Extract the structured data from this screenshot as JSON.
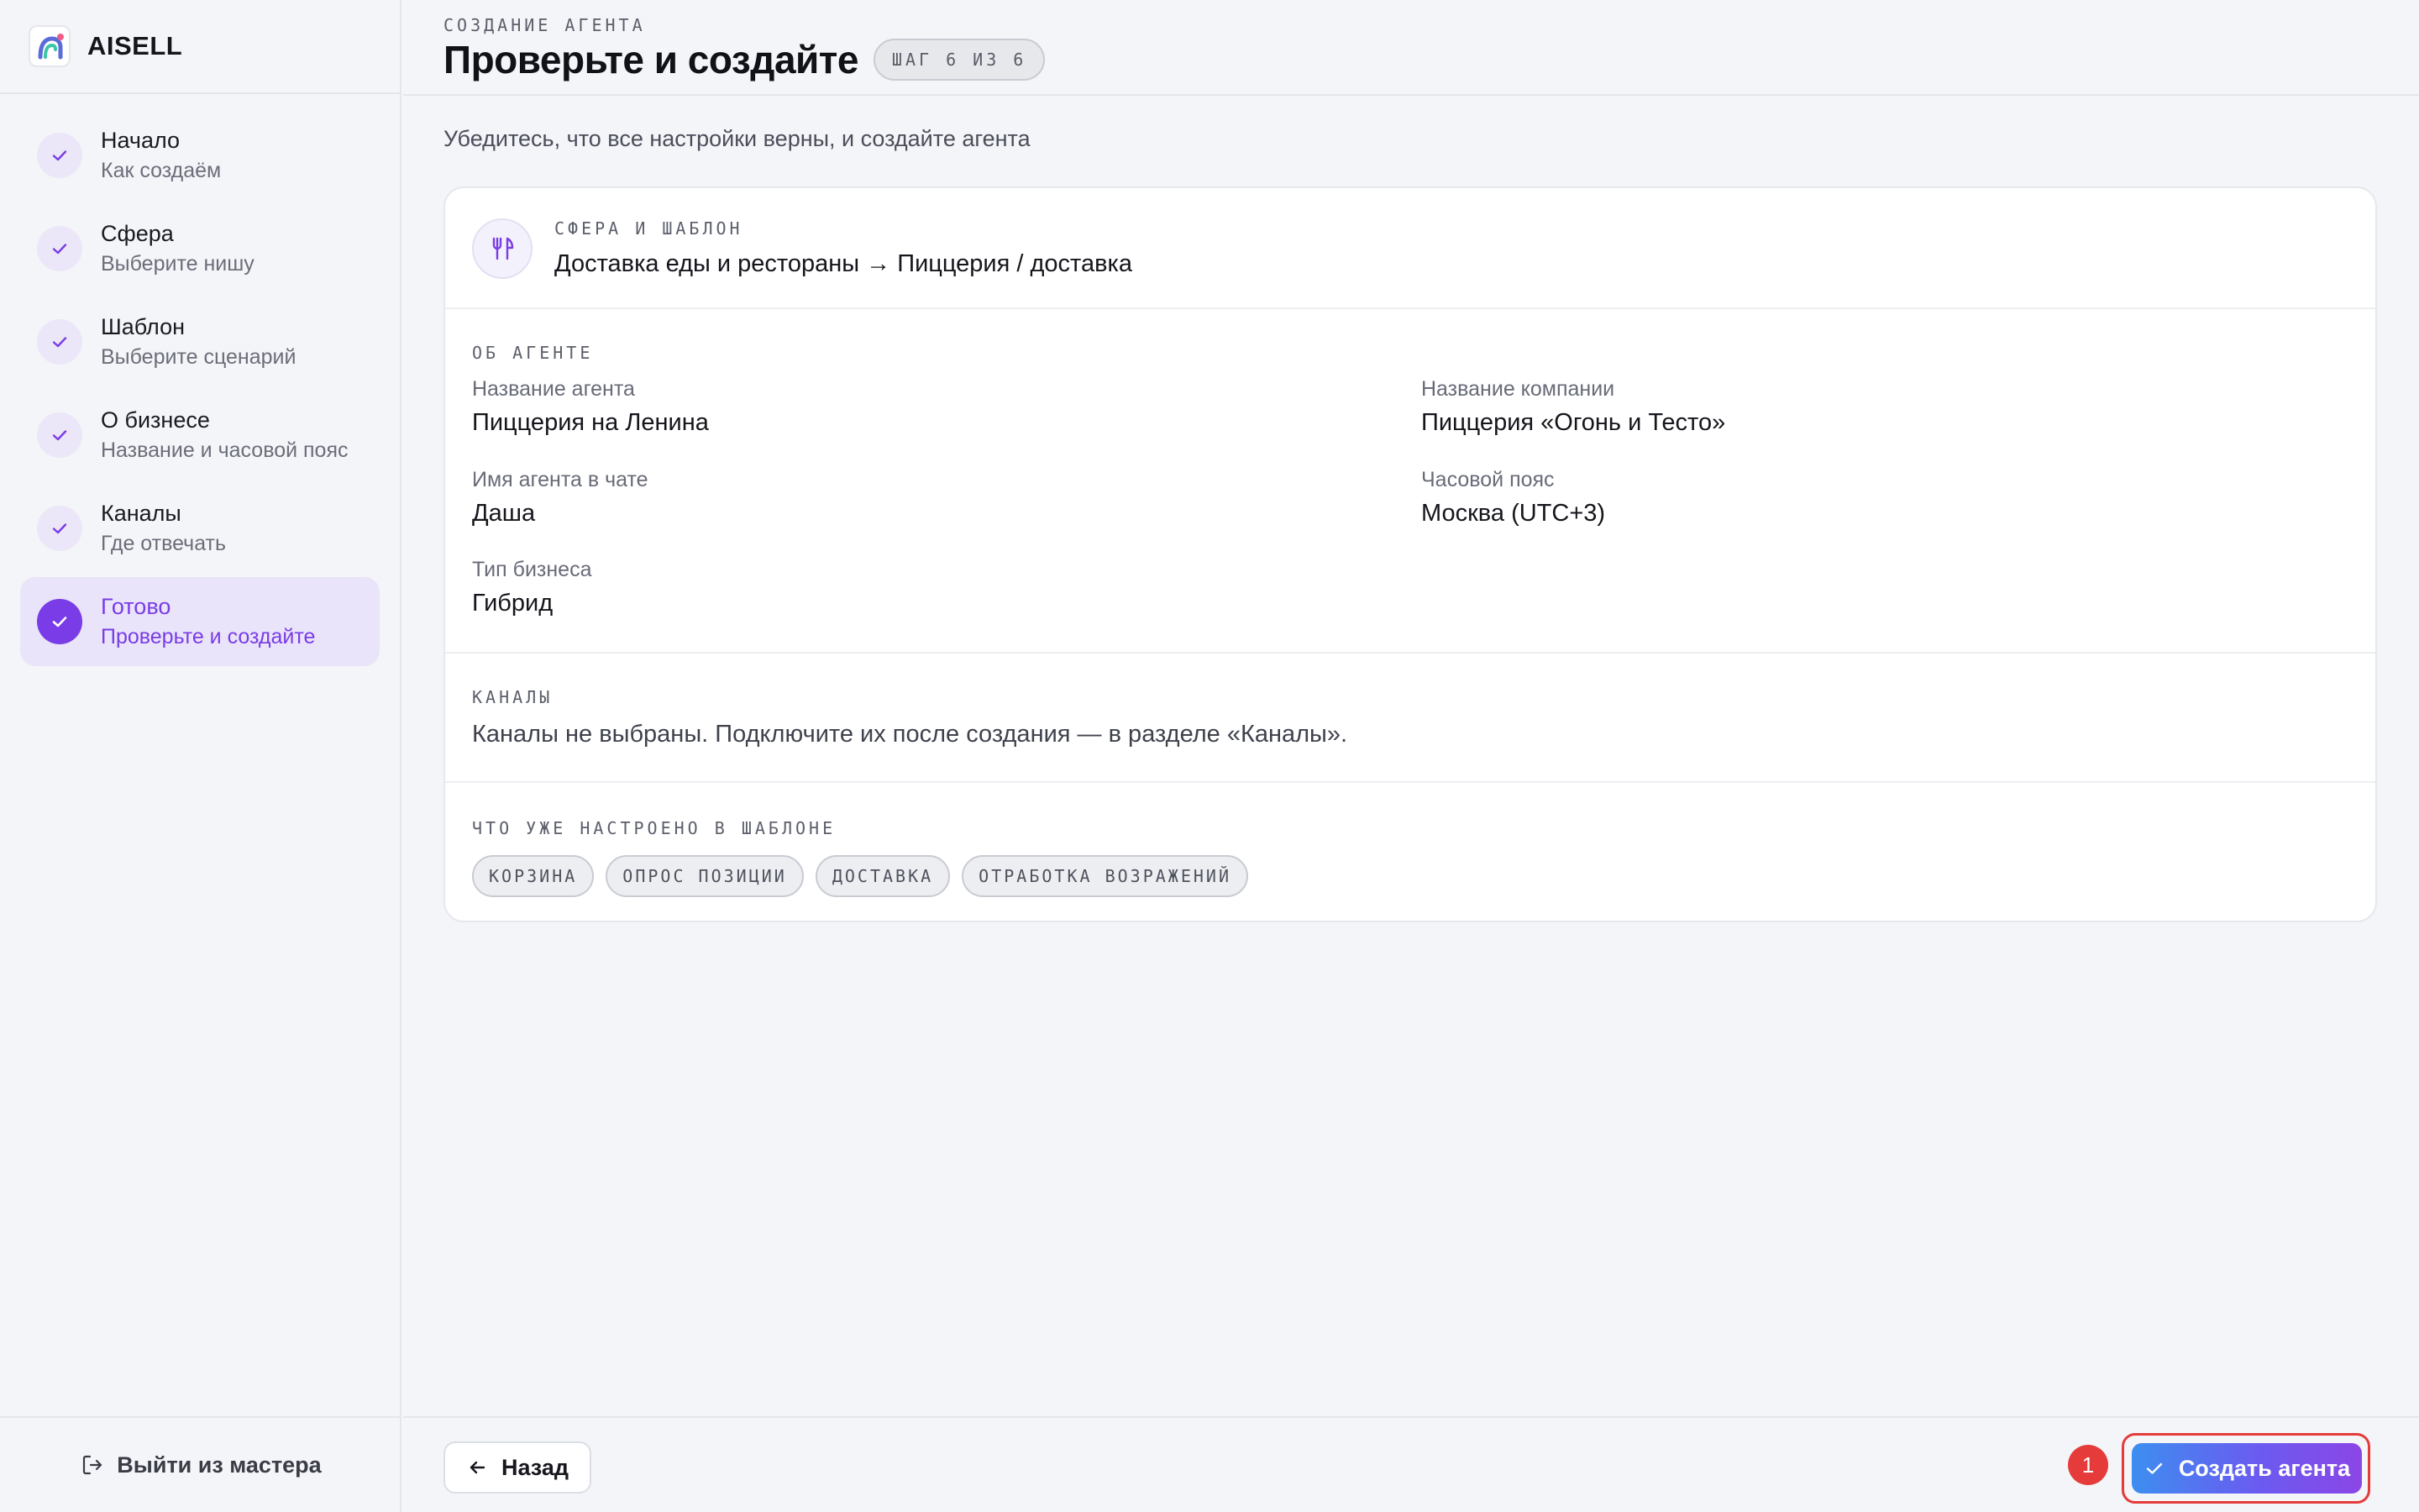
{
  "brand": {
    "name": "AISELL"
  },
  "steps": [
    {
      "title": "Начало",
      "subtitle": "Как создаём",
      "done": true
    },
    {
      "title": "Сфера",
      "subtitle": "Выберите нишу",
      "done": true
    },
    {
      "title": "Шаблон",
      "subtitle": "Выберите сценарий",
      "done": true
    },
    {
      "title": "О бизнесе",
      "subtitle": "Название и часовой пояс",
      "done": true
    },
    {
      "title": "Каналы",
      "subtitle": "Где отвечать",
      "done": true
    },
    {
      "title": "Готово",
      "subtitle": "Проверьте и создайте",
      "active": true
    }
  ],
  "sidebar": {
    "exit_label": "Выйти из мастера"
  },
  "header": {
    "eyebrow": "СОЗДАНИЕ АГЕНТА",
    "title": "Проверьте и создайте",
    "step_badge": "ШАГ 6 ИЗ 6"
  },
  "main": {
    "subtitle": "Убедитесь, что все настройки верны, и создайте агента",
    "sphere": {
      "label": "СФЕРА И ШАБЛОН",
      "icon": "fork-knife-icon",
      "value": "Доставка еды и рестораны → Пиццерия / доставка"
    },
    "about": {
      "label": "ОБ АГЕНТЕ",
      "agent_name_label": "Название агента",
      "agent_name": "Пиццерия на Ленина",
      "company_label": "Название компании",
      "company": "Пиццерия «Огонь и Тесто»",
      "chat_name_label": "Имя агента в чате",
      "chat_name": "Даша",
      "timezone_label": "Часовой пояс",
      "timezone": "Москва (UTC+3)",
      "business_type_label": "Тип бизнеса",
      "business_type": "Гибрид"
    },
    "channels": {
      "label": "КАНАЛЫ",
      "text": "Каналы не выбраны. Подключите их после создания — в разделе «Каналы»."
    },
    "template": {
      "label": "ЧТО УЖЕ НАСТРОЕНО В ШАБЛОНЕ",
      "chips": [
        "КОРЗИНА",
        "ОПРОС ПОЗИЦИИ",
        "ДОСТАВКА",
        "ОТРАБОТКА ВОЗРАЖЕНИЙ"
      ]
    }
  },
  "footer": {
    "back_label": "Назад",
    "marker": "1",
    "create_label": "Создать агента"
  },
  "colors": {
    "accent": "#7a3ce6",
    "active_bg": "#e9e4fa",
    "marker": "#e53b3b",
    "button_gradient_start": "#3d8ef0",
    "button_gradient_end": "#8b46e6"
  }
}
